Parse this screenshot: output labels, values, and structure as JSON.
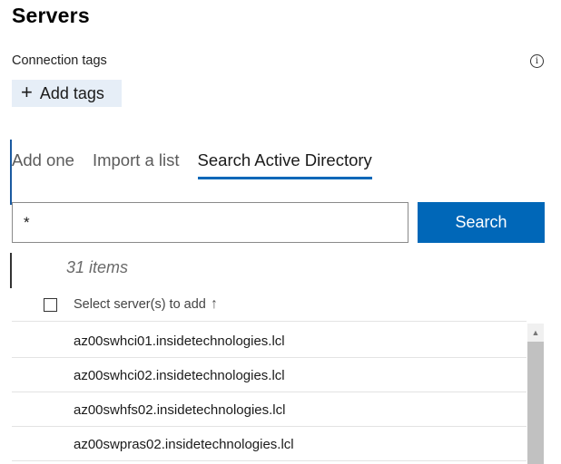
{
  "page": {
    "title": "Servers"
  },
  "tags": {
    "label": "Connection tags",
    "info_icon": "info-icon",
    "info_glyph": "i",
    "add_label": "Add tags",
    "add_icon": "plus-icon",
    "add_glyph": "+"
  },
  "tabs": [
    {
      "label": "Add one"
    },
    {
      "label": "Import a list"
    },
    {
      "label": "Search Active Directory",
      "active": true
    }
  ],
  "search": {
    "value": "*",
    "button_label": "Search"
  },
  "results": {
    "count_label": "31 items",
    "column_header": "Select server(s) to add",
    "sort_icon": "arrow-up-icon",
    "sort_glyph": "↑",
    "rows": [
      "az00swhci01.insidetechnologies.lcl",
      "az00swhci02.insidetechnologies.lcl",
      "az00swhfs02.insidetechnologies.lcl",
      "az00swpras02.insidetechnologies.lcl"
    ]
  },
  "scrollbar": {
    "up_glyph": "▲"
  },
  "colors": {
    "accent": "#0067b8",
    "tag_button_bg": "#e6eef7"
  }
}
